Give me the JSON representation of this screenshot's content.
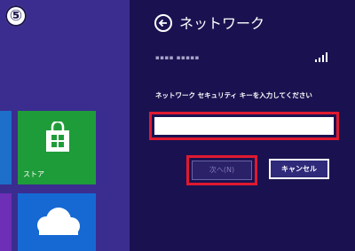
{
  "step": {
    "number": "⑤"
  },
  "start_screen": {
    "store_tile": {
      "label": "ストア",
      "icon": "store-bag-icon",
      "color": "#1f9c3a"
    },
    "skydrive_tile": {
      "icon": "cloud-icon",
      "color": "#1669d3"
    }
  },
  "panel": {
    "title": "ネットワーク",
    "back_icon": "back-arrow-icon",
    "network_name": "▪▪▪▪ ▪▪▪▪▪",
    "signal_icon": "wifi-signal-icon",
    "security_key_label": "ネットワーク セキュリティ キーを入力してください",
    "security_key_input": {
      "value": "",
      "placeholder": ""
    },
    "buttons": {
      "next": "次へ(N)",
      "cancel": "キャンセル"
    },
    "highlight_color": "#e0192f"
  }
}
